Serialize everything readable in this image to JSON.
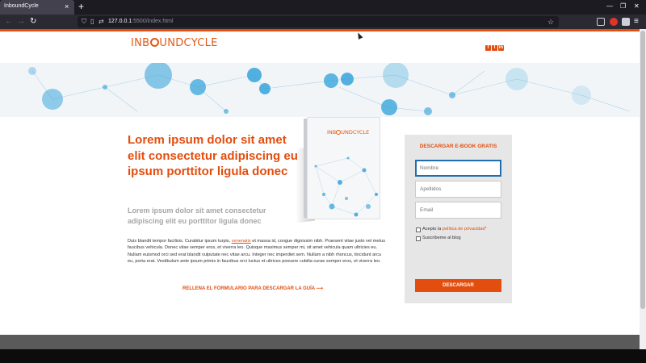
{
  "browser": {
    "tab_title": "InboundCycle",
    "tab_close": "×",
    "new_tab": "+",
    "url_host": "127.0.0.1",
    "url_path": ":5500/index.html",
    "win_minimize": "—",
    "win_restore": "❐",
    "win_close": "✕"
  },
  "site": {
    "logo_pre": "INB",
    "logo_post": "UNDCYCLE",
    "social_icons": [
      "facebook-icon",
      "twitter-icon",
      "linkedin-icon"
    ]
  },
  "main": {
    "headline": "Lorem ipsum dolor sit amet elit consectetur adipiscing eu ipsum porttitor ligula donec",
    "subhead": "Lorem ipsum dolor sit amet consectetur adipiscing elit eu porttitor ligula donec",
    "body_before_link": "Duis blandit tempor facilisis. Curabitur ipsum turpis, ",
    "body_link": "venenatis",
    "body_after_link": " et massa id, congue dignissim nibh. Praesent vitae justo vel metus faucibus vehicula. Donec vitae semper eros, et viverra leo. Quisque maximus semper mi, sit amet vehicula quam ultricies eu. Nullam euismod orci sed erat blandit vulputate nec vitae arcu. Integer nec imperdiet sem. Nullam a nibh rhoncus, tincidunt arcu eu, porta erat. Vestibulum ante ipsum primis in faucibus orci luctus et ultrices posuere cubilia curae semper eros, et viverra leo.",
    "cta": "RELLENA EL FORMULARIO PARA DESCARGAR LA GUÍA ⟶"
  },
  "book": {
    "logo_pre": "INB",
    "logo_post": "UNDCYCLE"
  },
  "form": {
    "title": "DESCARGAR E-BOOK GRATIS",
    "name_placeholder": "Nombre",
    "surname_placeholder": "Apellidos",
    "email_placeholder": "Email",
    "privacy_prefix": "Acepto la ",
    "privacy_link": "política de privacidad",
    "privacy_required": "*",
    "subscribe_label": "Suscribeme al blog",
    "submit_label": "DESCARGAR"
  },
  "colors": {
    "accent": "#e34d0e",
    "hero_blue": "#2b9fd9"
  }
}
